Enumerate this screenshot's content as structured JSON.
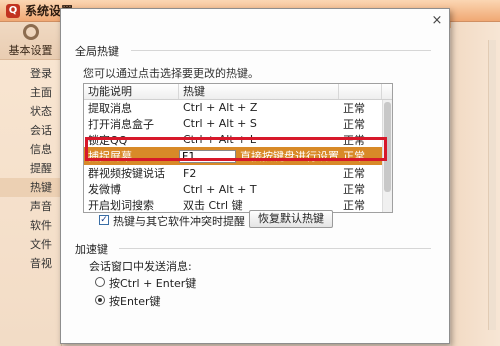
{
  "window": {
    "title": "系统设置"
  },
  "sidebar": {
    "header": "基本设置",
    "items": [
      {
        "label": "登录"
      },
      {
        "label": "主面"
      },
      {
        "label": "状态"
      },
      {
        "label": "会话"
      },
      {
        "label": "信息"
      },
      {
        "label": "提醒"
      },
      {
        "label": "热键"
      },
      {
        "label": "声音"
      },
      {
        "label": "软件"
      },
      {
        "label": "文件"
      },
      {
        "label": "音视"
      }
    ]
  },
  "dialog": {
    "close_glyph": "×",
    "section_global": "全局热键",
    "hint": "您可以通过点击选择要更改的热键。",
    "table": {
      "headers": [
        "功能说明",
        "热键",
        ""
      ],
      "rows": [
        {
          "name": "提取消息",
          "key": "Ctrl + Alt + Z",
          "status": "正常"
        },
        {
          "name": "打开消息盒子",
          "key": "Ctrl + Alt + S",
          "status": "正常"
        },
        {
          "name": "锁定QQ",
          "key": "Ctrl + Alt + L",
          "status": "正常"
        },
        {
          "name": "捕捉屏幕",
          "key": "F1",
          "status": "正常",
          "edit_hint": "直接按键盘进行设置"
        },
        {
          "name": "群视频按键说话",
          "key": "F2",
          "status": "正常"
        },
        {
          "name": "发微博",
          "key": "Ctrl + Alt + T",
          "status": "正常"
        },
        {
          "name": "开启划词搜索",
          "key": "双击 Ctrl 键",
          "status": "正常"
        }
      ]
    },
    "conflict_checkbox": {
      "label": "热键与其它软件冲突时提醒",
      "checked": true,
      "mark": "✓"
    },
    "restore_button": "恢复默认热键",
    "section_speed": "加速键",
    "send_label": "会话窗口中发送消息:",
    "radio_ctrl_enter": "按Ctrl + Enter键",
    "radio_enter": "按Enter键"
  }
}
